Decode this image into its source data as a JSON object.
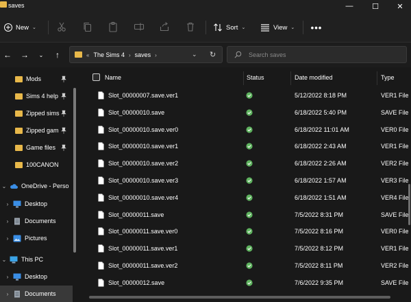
{
  "window": {
    "title": "saves"
  },
  "toolbar": {
    "new_label": "New",
    "sort_label": "Sort",
    "view_label": "View",
    "more_label": "•••"
  },
  "address": {
    "crumbs": [
      "The Sims 4",
      "saves"
    ],
    "search_placeholder": "Search saves"
  },
  "sidebar": {
    "quick_access": [
      {
        "label": "Mods",
        "pinned": true
      },
      {
        "label": "Sims 4 help",
        "pinned": true
      },
      {
        "label": "Zipped sims",
        "pinned": true
      },
      {
        "label": "Zipped gam",
        "pinned": true
      },
      {
        "label": "Game files",
        "pinned": true
      },
      {
        "label": "100CANON",
        "pinned": false
      }
    ],
    "onedrive": {
      "label": "OneDrive - Perso",
      "children": [
        "Desktop",
        "Documents",
        "Pictures"
      ]
    },
    "thispc": {
      "label": "This PC",
      "children": [
        "Desktop",
        "Documents"
      ]
    }
  },
  "columns": {
    "name": "Name",
    "status": "Status",
    "date": "Date modified",
    "type": "Type"
  },
  "files": [
    {
      "name": "Slot_00000007.save.ver1",
      "date": "5/12/2022 8:18 PM",
      "type": "VER1 File"
    },
    {
      "name": "Slot_00000010.save",
      "date": "6/18/2022 5:40 PM",
      "type": "SAVE File"
    },
    {
      "name": "Slot_00000010.save.ver0",
      "date": "6/18/2022 11:01 AM",
      "type": "VER0 File"
    },
    {
      "name": "Slot_00000010.save.ver1",
      "date": "6/18/2022 2:43 AM",
      "type": "VER1 File"
    },
    {
      "name": "Slot_00000010.save.ver2",
      "date": "6/18/2022 2:26 AM",
      "type": "VER2 File"
    },
    {
      "name": "Slot_00000010.save.ver3",
      "date": "6/18/2022 1:57 AM",
      "type": "VER3 File"
    },
    {
      "name": "Slot_00000010.save.ver4",
      "date": "6/18/2022 1:51 AM",
      "type": "VER4 File"
    },
    {
      "name": "Slot_00000011.save",
      "date": "7/5/2022 8:31 PM",
      "type": "SAVE File"
    },
    {
      "name": "Slot_00000011.save.ver0",
      "date": "7/5/2022 8:16 PM",
      "type": "VER0 File"
    },
    {
      "name": "Slot_00000011.save.ver1",
      "date": "7/5/2022 8:12 PM",
      "type": "VER1 File"
    },
    {
      "name": "Slot_00000011.save.ver2",
      "date": "7/5/2022 8:11 PM",
      "type": "VER2 File"
    },
    {
      "name": "Slot_00000012.save",
      "date": "7/6/2022 9:35 PM",
      "type": "SAVE File"
    }
  ],
  "colors": {
    "accent_folder": "#e8b84a",
    "status_ok": "#5fb35f",
    "selected_bg": "#393939"
  }
}
